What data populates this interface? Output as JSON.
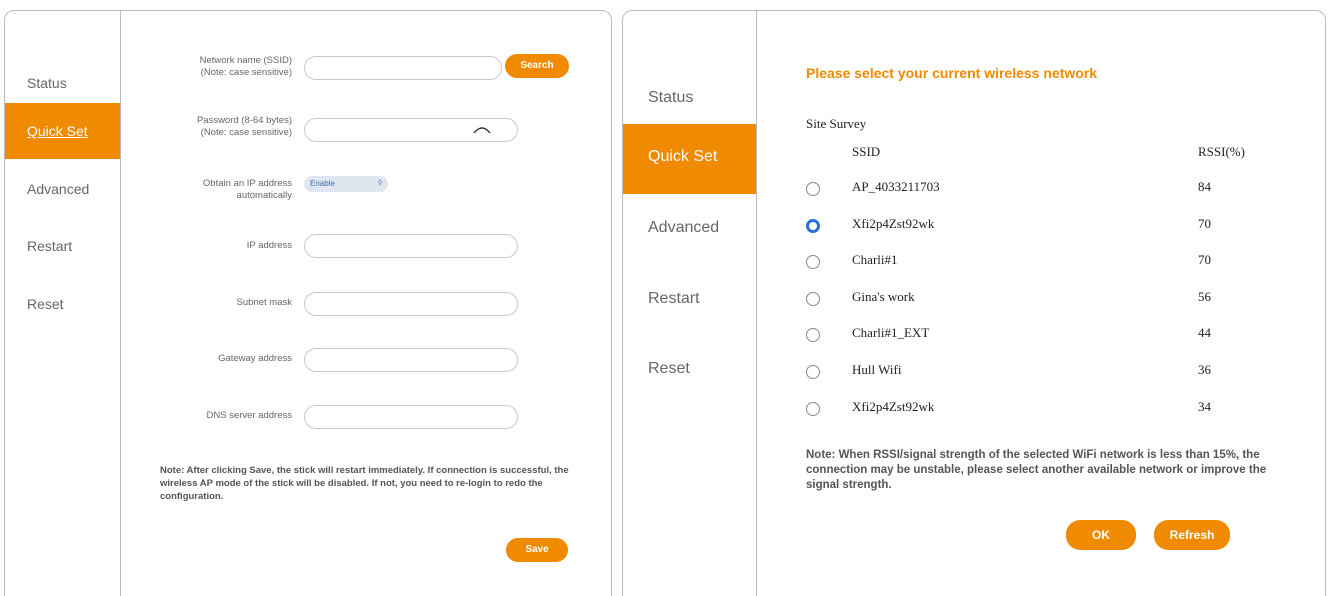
{
  "left": {
    "nav": [
      "Status",
      "Quick Set",
      "Advanced",
      "Restart",
      "Reset"
    ],
    "active_nav": "Quick Set",
    "fields": {
      "ssid_label_1": "Network name (SSID)",
      "ssid_label_2": "(Note: case sensitive)",
      "ssid_value": "",
      "search_label": "Search",
      "password_label_1": "Password (8-64 bytes)",
      "password_label_2": "(Note: case sensitive)",
      "password_value": "",
      "obtain_ip_label_1": "Obtain an IP address",
      "obtain_ip_label_2": "automatically",
      "obtain_ip_value": "Enable",
      "ip_label": "IP address",
      "subnet_label": "Subnet mask",
      "gateway_label": "Gateway address",
      "dns_label": "DNS server address"
    },
    "note": "Note: After clicking Save, the stick will restart immediately. If connection is successful, the wireless AP mode of the stick will be disabled. If not, you need to re-login to redo the configuration.",
    "save_label": "Save"
  },
  "right": {
    "nav": [
      "Status",
      "Quick Set",
      "Advanced",
      "Restart",
      "Reset"
    ],
    "active_nav": "Quick Set",
    "heading": "Please select your current wireless network",
    "site_survey": "Site Survey",
    "col_ssid": "SSID",
    "col_rssi": "RSSI(%)",
    "networks": [
      {
        "ssid": "AP_4033211703",
        "rssi": "84",
        "selected": false
      },
      {
        "ssid": "Xfi2p4Zst92wk",
        "rssi": "70",
        "selected": true
      },
      {
        "ssid": "Charli#1",
        "rssi": "70",
        "selected": false
      },
      {
        "ssid": "Gina's work",
        "rssi": "56",
        "selected": false
      },
      {
        "ssid": "Charli#1_EXT",
        "rssi": "44",
        "selected": false
      },
      {
        "ssid": "Hull Wifi",
        "rssi": "36",
        "selected": false
      },
      {
        "ssid": "Xfi2p4Zst92wk",
        "rssi": "34",
        "selected": false
      }
    ],
    "note": "Note: When RSSI/signal strength of the selected WiFi network is less than 15%, the connection may be unstable, please select another available network or improve the signal strength.",
    "ok_label": "OK",
    "refresh_label": "Refresh"
  },
  "colors": {
    "accent": "#f08a00",
    "radio_selected": "#2a6fd6",
    "select_bg": "#dfe6ef"
  },
  "icons": {
    "password_toggle": "eye-icon",
    "select_arrow": "chevron-icon"
  }
}
